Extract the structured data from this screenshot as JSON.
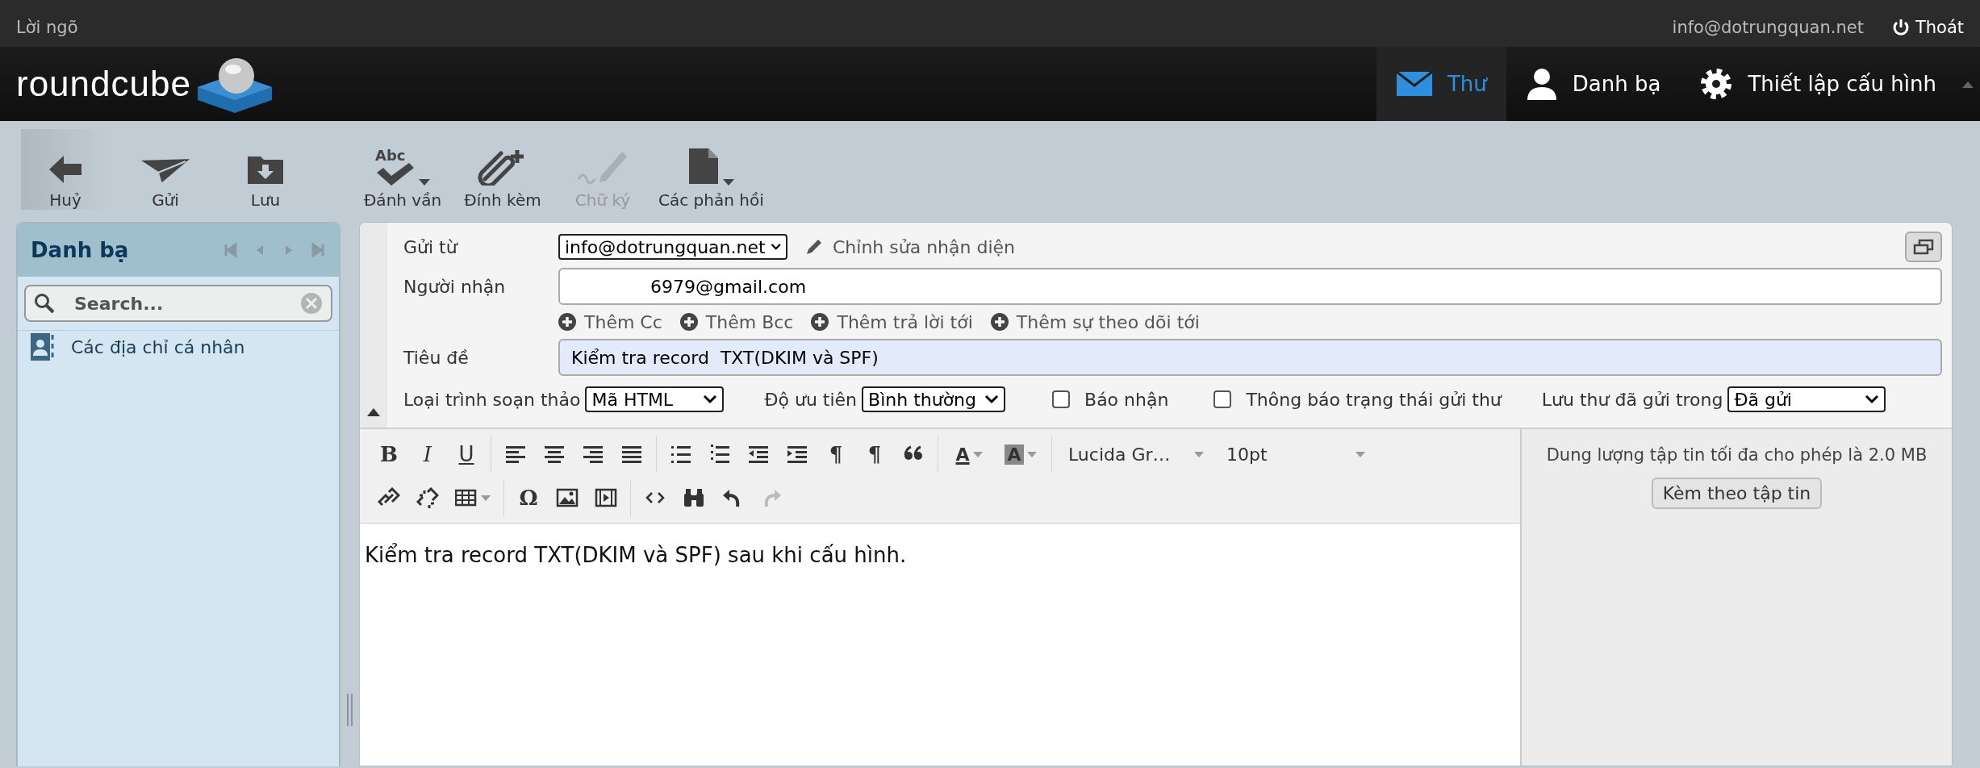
{
  "topbar": {
    "greeting": "Lời ngõ",
    "user": "info@dotrungquan.net",
    "logout": "Thoát"
  },
  "header": {
    "logo": "roundcube",
    "nav": [
      {
        "label": "Thư",
        "kind": "mail",
        "selected": true
      },
      {
        "label": "Danh bạ",
        "kind": "contacts",
        "selected": false
      },
      {
        "label": "Thiết lập cấu hình",
        "kind": "settings",
        "selected": false
      }
    ]
  },
  "toolbar": [
    {
      "items": [
        {
          "label": "Huỷ",
          "kind": "back",
          "disabled": false,
          "menu": false
        },
        {
          "label": "Gửi",
          "kind": "send",
          "disabled": false,
          "menu": false
        },
        {
          "label": "Lưu",
          "kind": "save",
          "disabled": false,
          "menu": false
        }
      ]
    },
    {
      "items": [
        {
          "label": "Đánh vần",
          "kind": "spell",
          "icon_text": "Abc",
          "disabled": false,
          "menu": true
        },
        {
          "label": "Đính kèm",
          "kind": "attach",
          "disabled": false,
          "menu": false
        },
        {
          "label": "Chữ ký",
          "kind": "signature",
          "disabled": true,
          "menu": false
        },
        {
          "label": "Các phản hồi",
          "kind": "responses",
          "disabled": false,
          "menu": true
        }
      ]
    }
  ],
  "sidebar": {
    "title": "Danh bạ",
    "search": {
      "placeholder": "Search..."
    },
    "items": [
      {
        "label": "Các địa chỉ cá nhân"
      }
    ]
  },
  "compose": {
    "from": {
      "label": "Gửi từ",
      "value": "info@dotrungquan.net",
      "edit_identity": "Chỉnh sửa nhận diện"
    },
    "to": {
      "label": "Người nhận",
      "value": "6979@gmail.com"
    },
    "add_links": [
      "Thêm Cc",
      "Thêm Bcc",
      "Thêm trả lời tới",
      "Thêm sự theo dõi tới"
    ],
    "subject": {
      "label": "Tiêu đề",
      "value": "Kiểm tra record  TXT(DKIM và SPF)"
    },
    "options": [
      {
        "kind": "select",
        "label": "Loại trình soạn thảo",
        "value": "Mã HTML"
      },
      {
        "kind": "select",
        "label": "Độ ưu tiên",
        "value": "Bình thường"
      },
      {
        "kind": "checkbox",
        "label": "Báo nhận",
        "checked": false
      },
      {
        "kind": "checkbox",
        "label": "Thông báo trạng thái gửi thư",
        "checked": false
      },
      {
        "kind": "select",
        "label": "Lưu thư đã gửi trong",
        "value": "Đã gửi"
      }
    ]
  },
  "editor": {
    "rows": [
      [
        [
          {
            "kind": "bold",
            "label": "B",
            "menu": false,
            "disabled": false
          },
          {
            "kind": "italic",
            "label": "I",
            "menu": false,
            "disabled": false
          },
          {
            "kind": "underline",
            "label": "U",
            "menu": false,
            "disabled": false
          }
        ],
        [
          {
            "kind": "align-left",
            "menu": false,
            "disabled": false
          },
          {
            "kind": "align-center",
            "menu": false,
            "disabled": false
          },
          {
            "kind": "align-right",
            "menu": false,
            "disabled": false
          },
          {
            "kind": "justify",
            "menu": false,
            "disabled": false
          }
        ],
        [
          {
            "kind": "bullet-list",
            "menu": false,
            "disabled": false
          },
          {
            "kind": "number-list",
            "menu": false,
            "disabled": false
          },
          {
            "kind": "outdent",
            "menu": false,
            "disabled": false
          },
          {
            "kind": "indent",
            "menu": false,
            "disabled": false
          },
          {
            "kind": "ltr",
            "label": "¶",
            "menu": false,
            "disabled": false
          },
          {
            "kind": "rtl",
            "label": "¶",
            "menu": false,
            "disabled": false
          },
          {
            "kind": "blockquote",
            "menu": false,
            "disabled": false
          }
        ],
        [
          {
            "kind": "text-color",
            "label": "A",
            "menu": true,
            "disabled": false
          },
          {
            "kind": "background-color",
            "label": "A",
            "menu": true,
            "disabled": false
          }
        ],
        [
          {
            "kind": "listbox",
            "label": "Lucida Gr…",
            "menu": true,
            "disabled": false
          },
          {
            "kind": "listbox",
            "label": "10pt",
            "menu": true,
            "disabled": false
          }
        ]
      ],
      [
        [
          {
            "kind": "link",
            "menu": false,
            "disabled": false
          },
          {
            "kind": "unlink",
            "menu": false,
            "disabled": false
          },
          {
            "kind": "table",
            "menu": true,
            "disabled": false
          }
        ],
        [
          {
            "kind": "special-char",
            "label": "Ω",
            "menu": false,
            "disabled": false
          },
          {
            "kind": "image",
            "menu": false,
            "disabled": false
          },
          {
            "kind": "media",
            "menu": false,
            "disabled": false
          }
        ],
        [
          {
            "kind": "code",
            "menu": false,
            "disabled": false
          },
          {
            "kind": "find",
            "menu": false,
            "disabled": false
          },
          {
            "kind": "undo",
            "menu": false,
            "disabled": false
          },
          {
            "kind": "redo",
            "menu": false,
            "disabled": true
          }
        ]
      ]
    ],
    "body": "Kiểm tra record TXT(DKIM và SPF) sau khi cấu hình."
  },
  "attachments": {
    "note": "Dung lượng tập tin tối đa cho phép là 2.0 MB",
    "button": "Kèm theo tập tin"
  }
}
